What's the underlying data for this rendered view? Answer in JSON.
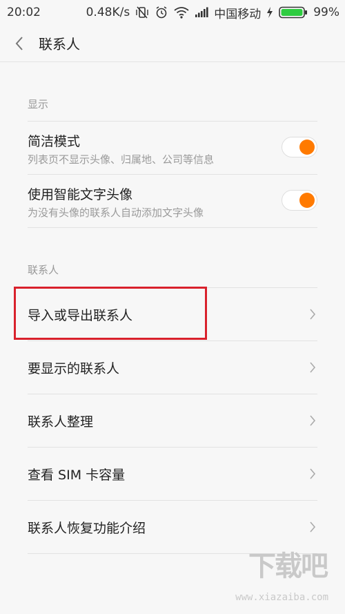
{
  "status_bar": {
    "time": "20:02",
    "network_speed": "0.48K/s",
    "carrier": "中国移动",
    "battery": "99%"
  },
  "header": {
    "title": "联系人"
  },
  "sections": {
    "display": {
      "header": "显示",
      "items": [
        {
          "title": "简洁模式",
          "subtitle": "列表页不显示头像、归属地、公司等信息",
          "toggle_on": true
        },
        {
          "title": "使用智能文字头像",
          "subtitle": "为没有头像的联系人自动添加文字头像",
          "toggle_on": true
        }
      ]
    },
    "contacts": {
      "header": "联系人",
      "items": [
        {
          "title": "导入或导出联系人"
        },
        {
          "title": "要显示的联系人"
        },
        {
          "title": "联系人整理"
        },
        {
          "title": "查看 SIM 卡容量"
        },
        {
          "title": "联系人恢复功能介绍"
        }
      ]
    }
  },
  "watermark": {
    "logo_text": "下载吧",
    "url": "www.xiazaiba.com"
  },
  "colors": {
    "toggle_knob": "#ff7a00",
    "highlight": "#d9212c",
    "background": "#f7f7f7"
  }
}
